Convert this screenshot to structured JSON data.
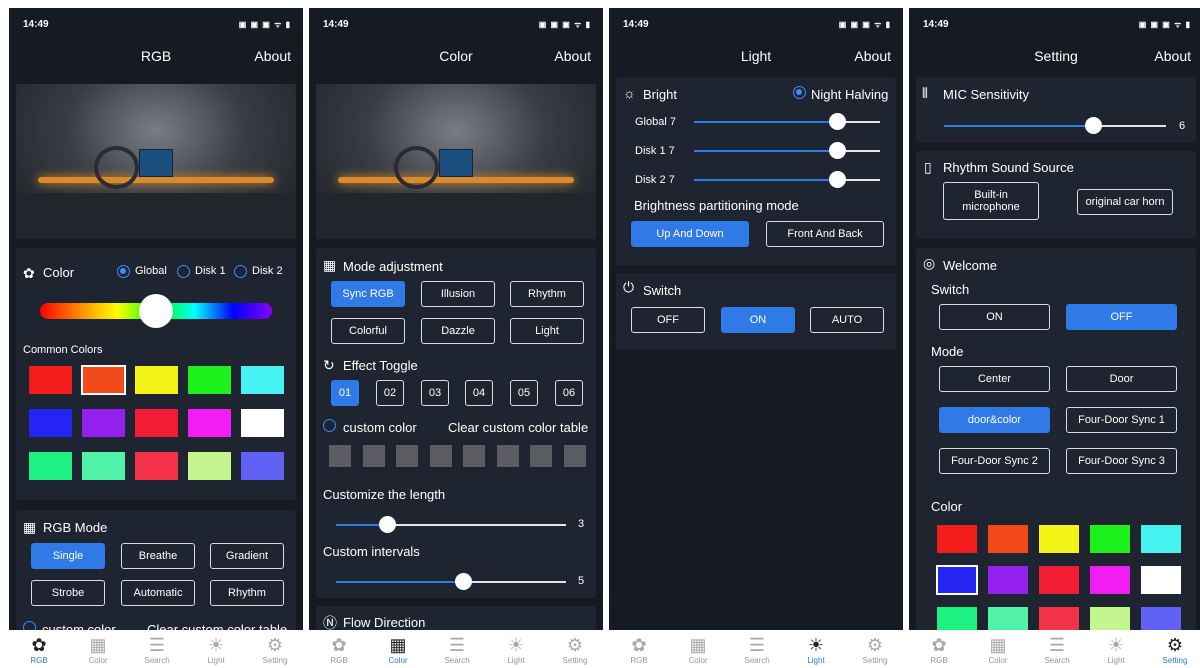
{
  "status": {
    "time": "14:49",
    "icons": "▣ ▣ ▣ ᯤ ▮"
  },
  "nav": [
    {
      "label": "RGB",
      "icon": "✿"
    },
    {
      "label": "Color",
      "icon": "▦"
    },
    {
      "label": "Search",
      "icon": "☰"
    },
    {
      "label": "Light",
      "icon": "☀"
    },
    {
      "label": "Setting",
      "icon": "⚙"
    }
  ],
  "about": "About",
  "s1": {
    "title": "RGB",
    "color_label": "Color",
    "global": "Global",
    "disk1": "Disk 1",
    "disk2": "Disk 2",
    "hue_knob": 0.5,
    "common_colors": "Common Colors",
    "swatches": [
      "#f41b1b",
      "#f24a1a",
      "#f5f316",
      "#1df11d",
      "#45f1f1",
      "#2424f5",
      "#9420f0",
      "#f21c34",
      "#f21cf5",
      "#ffffff",
      "#1df182",
      "#4ff2a6",
      "#f4334a",
      "#c5f58e",
      "#6060f5"
    ],
    "selected_swatch": 1,
    "rgb_mode": "RGB Mode",
    "modes": [
      "Single",
      "Breathe",
      "Gradient",
      "Strobe",
      "Automatic",
      "Rhythm"
    ],
    "custom_color": "custom color",
    "clear_custom": "Clear custom color table"
  },
  "s2": {
    "title": "Color",
    "mode_adj": "Mode adjustment",
    "modes": [
      "Sync RGB",
      "Illusion",
      "Rhythm",
      "Colorful",
      "Dazzle",
      "Light"
    ],
    "effect_toggle": "Effect Toggle",
    "effects": [
      "01",
      "02",
      "03",
      "04",
      "05",
      "06"
    ],
    "custom_color": "custom color",
    "clear_custom": "Clear custom color table",
    "customize_length": "Customize the length",
    "length_value": "3",
    "length_pos": 0.22,
    "custom_intervals": "Custom intervals",
    "intervals_value": "5",
    "intervals_pos": 0.55,
    "flow_direction": "Flow Direction"
  },
  "s3": {
    "title": "Light",
    "bright": "Bright",
    "night": "Night Halving",
    "sliders": [
      {
        "label": "Global 7",
        "pos": 0.77
      },
      {
        "label": "Disk 1 7",
        "pos": 0.77
      },
      {
        "label": "Disk 2 7",
        "pos": 0.77
      }
    ],
    "partition": "Brightness partitioning mode",
    "up_down": "Up And Down",
    "front_back": "Front And Back",
    "switch": "Switch",
    "off": "OFF",
    "on": "ON",
    "auto": "AUTO"
  },
  "s4": {
    "title": "Setting",
    "mic": "MIC Sensitivity",
    "mic_value": "6",
    "mic_pos": 0.67,
    "rhythm_source": "Rhythm Sound Source",
    "builtin": "Built-in microphone",
    "carhorn": "original car horn",
    "welcome": "Welcome",
    "switch": "Switch",
    "on": "ON",
    "off": "OFF",
    "mode": "Mode",
    "modes": [
      "Center",
      "Door",
      "door&color",
      "Four-Door Sync 1",
      "Four-Door Sync 2",
      "Four-Door Sync 3"
    ],
    "color": "Color",
    "swatches": [
      "#f41b1b",
      "#f24a1a",
      "#f5f316",
      "#1df11d",
      "#45f1f1",
      "#2424f5",
      "#9420f0",
      "#f21c34",
      "#f21cf5",
      "#ffffff",
      "#1df182",
      "#4ff2a6",
      "#f4334a",
      "#c5f58e",
      "#6060f5"
    ],
    "selected_swatch": 5
  }
}
